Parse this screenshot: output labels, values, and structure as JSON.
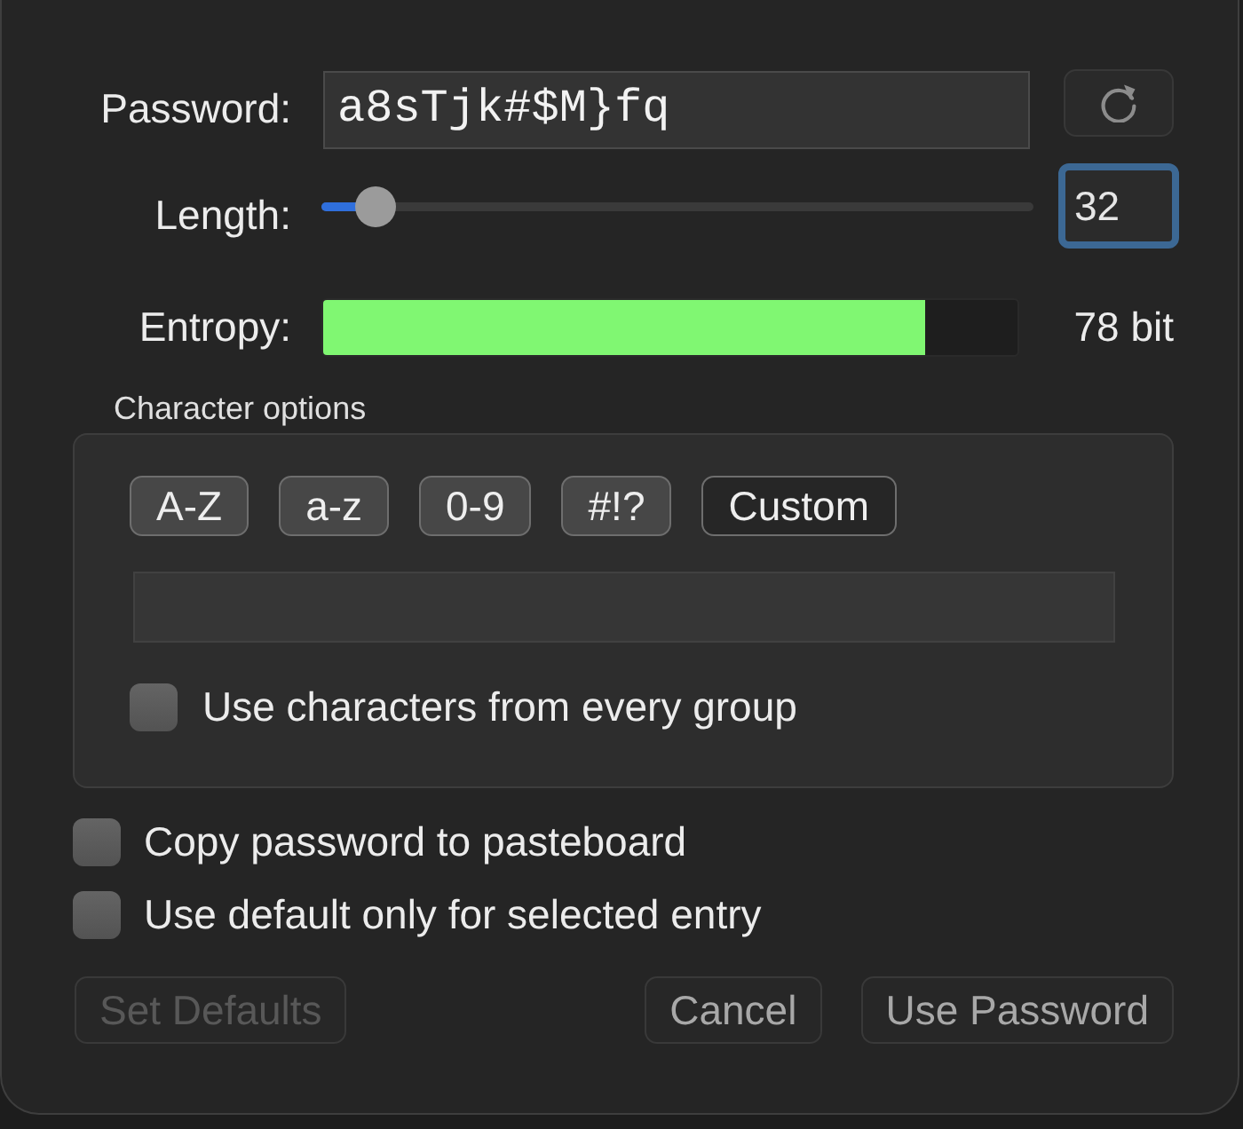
{
  "password": {
    "label": "Password:",
    "value": "a8sTjk#$M}fq"
  },
  "length": {
    "label": "Length:",
    "level": 0.075,
    "value": "32",
    "focused": true
  },
  "entropy": {
    "label": "Entropy:",
    "level": 0.866,
    "reading": "78 bit"
  },
  "character_options": {
    "title": "Character options",
    "groups": [
      {
        "label": "A-Z",
        "selected": true
      },
      {
        "label": "a-z",
        "selected": true
      },
      {
        "label": "0-9",
        "selected": true
      },
      {
        "label": "#!?",
        "selected": true
      },
      {
        "label": "Custom",
        "selected": false
      }
    ],
    "every_group": {
      "label": "Use characters from every group",
      "checked": false
    }
  },
  "options": [
    {
      "label": "Copy password to pasteboard",
      "checked": false
    },
    {
      "label": "Use default only for selected entry",
      "checked": false
    }
  ],
  "buttons": [
    {
      "label": "Set Defaults",
      "disabled": true
    },
    {
      "label": "Cancel",
      "disabled": false
    },
    {
      "label": "Use Password",
      "disabled": false
    }
  ]
}
